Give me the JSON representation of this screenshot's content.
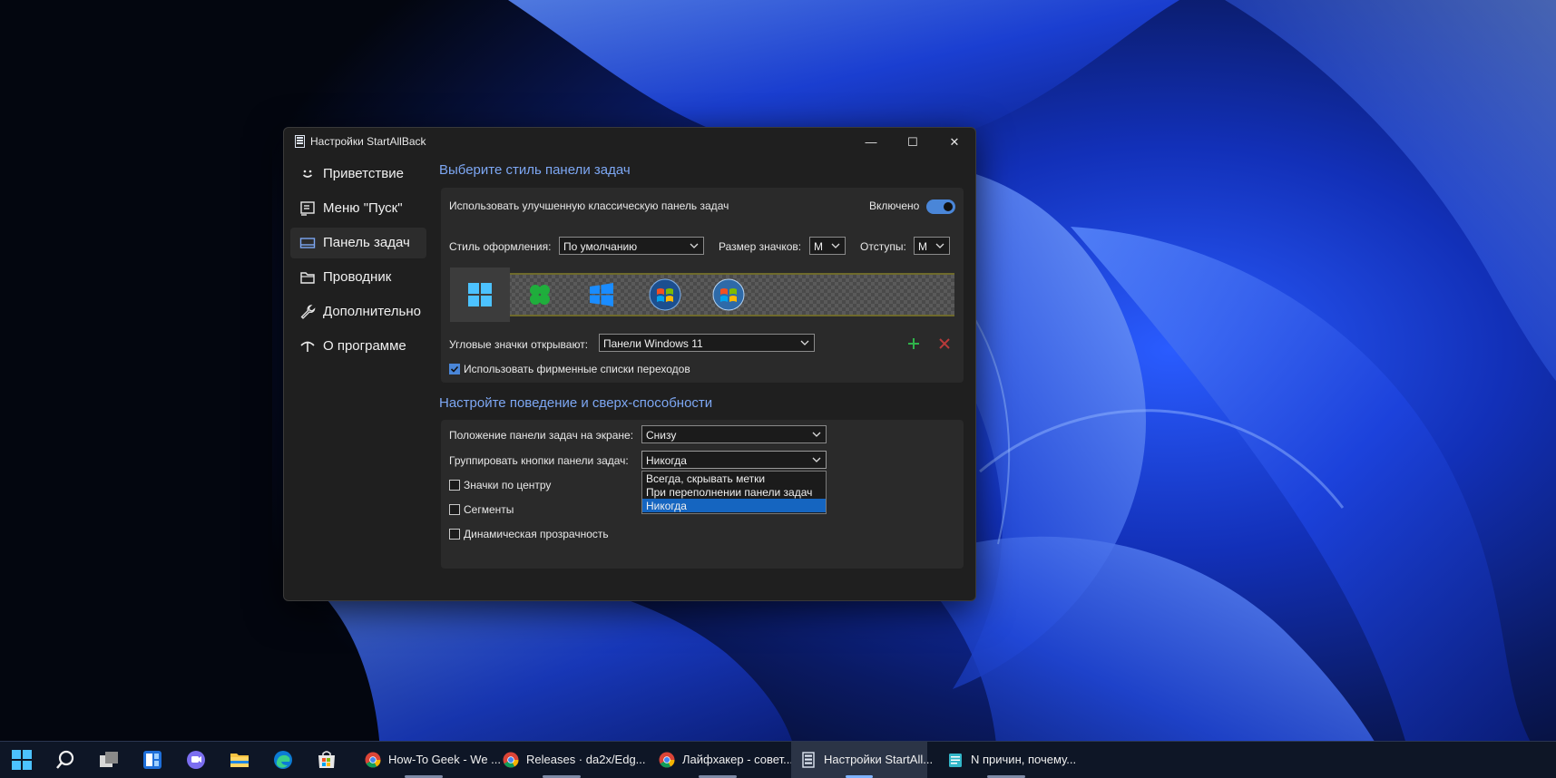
{
  "window": {
    "title": "Настройки StartAllBack",
    "controls": {
      "minimize": "—",
      "maximize": "☐",
      "close": "✕"
    }
  },
  "sidebar": {
    "items": [
      {
        "label": "Приветствие",
        "icon": "smile-icon",
        "active": false
      },
      {
        "label": "Меню \"Пуск\"",
        "icon": "start-menu-icon",
        "active": false
      },
      {
        "label": "Панель задач",
        "icon": "taskbar-icon",
        "active": true
      },
      {
        "label": "Проводник",
        "icon": "folder-icon",
        "active": false
      },
      {
        "label": "Дополнительно",
        "icon": "wrench-icon",
        "active": false
      },
      {
        "label": "О программе",
        "icon": "about-icon",
        "active": false
      }
    ]
  },
  "taskbar_style": {
    "section_title": "Выберите стиль панели задач",
    "classic_label": "Использовать улучшенную классическую панель задач",
    "toggle_label": "Включено",
    "toggle_on": true,
    "style_label": "Стиль оформления:",
    "style_value": "По умолчанию",
    "icon_size_label": "Размер значков:",
    "icon_size_value": "M",
    "padding_label": "Отступы:",
    "padding_value": "M",
    "corner_label": "Угловые значки открывают:",
    "corner_value": "Панели Windows 11",
    "jumplists_label": "Использовать фирменные списки переходов",
    "jumplists_checked": true,
    "start_styles": [
      "windows-11-logo",
      "windows-xp-clover",
      "windows-10-logo",
      "windows-7-orb",
      "windows-vista-orb"
    ]
  },
  "behavior": {
    "section_title": "Настройте поведение и сверх-способности",
    "position_label": "Положение панели задач на экране:",
    "position_value": "Снизу",
    "group_label": "Группировать кнопки панели задач:",
    "group_value": "Никогда",
    "group_options": [
      "Всегда, скрывать метки",
      "При переполнении панели задач",
      "Никогда"
    ],
    "group_selected_index": 2,
    "center_label": "Значки по центру",
    "segments_label": "Сегменты",
    "transparency_label": "Динамическая прозрачность"
  },
  "taskbar": {
    "pinned": [
      "start-icon",
      "search-icon",
      "task-view-icon",
      "widgets-icon",
      "teams-chat-icon",
      "file-explorer-icon",
      "edge-icon",
      "store-icon"
    ],
    "apps": [
      {
        "label": "How-To Geek - We ...",
        "icon": "chrome-icon",
        "active": false
      },
      {
        "label": "Releases · da2x/Edg...",
        "icon": "chrome-icon",
        "active": false
      },
      {
        "label": "Лайфхакер - совет...",
        "icon": "chrome-icon",
        "active": false
      },
      {
        "label": "Настройки StartAll...",
        "icon": "startallback-icon",
        "active": true
      },
      {
        "label": "N причин, почему...",
        "icon": "notepad-icon",
        "active": false
      }
    ]
  },
  "colors": {
    "accent": "#4a86d8",
    "section_title": "#7da7f3",
    "window_bg": "#1f1f1f",
    "panel_bg": "#2a2a2a",
    "dropdown_selection": "#1565c0"
  }
}
